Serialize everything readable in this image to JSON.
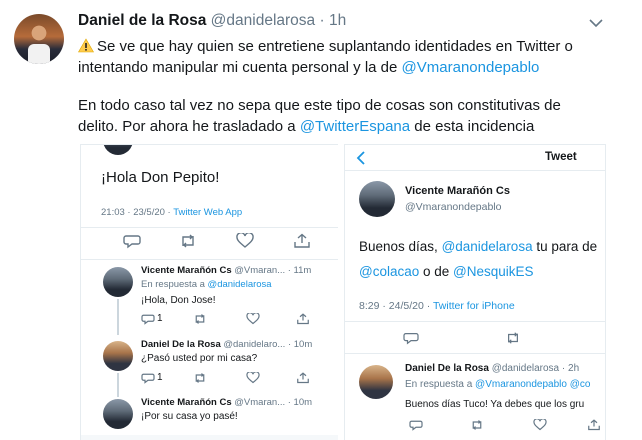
{
  "tweet": {
    "author_name": "Daniel de la Rosa",
    "author_handle": "@danidelarosa",
    "separator": "·",
    "time": "1h",
    "line1_pre": "Se ve que hay quien se entretiene suplantando identidades en Twitter o",
    "line2_pre": "intentando manipular mi cuenta personal y la de ",
    "mention1": "@Vmaranondepablo",
    "line3": "En todo caso tal vez no sepa que este tipo de cosas son constitutivas de",
    "line4_pre": "delito. Por ahora he trasladado a ",
    "mention2": "@TwitterEspana",
    "line4_post": " de esta incidencia"
  },
  "left_shot": {
    "main_text": "¡Hola Don Pepito!",
    "meta_time": "21:03 · 23/5/20 · ",
    "meta_app": "Twitter Web App",
    "replies": [
      {
        "name": "Vicente Marañón Cs",
        "handle": "@Vmaran...",
        "time": "· 11m",
        "reply_to_label": "En respuesta a ",
        "reply_to": "@danidelarosa",
        "text": "¡Hola, Don Jose!",
        "reply_count": "1"
      },
      {
        "name": "Daniel De la Rosa",
        "handle": "@danidelaro...",
        "time": "· 10m",
        "text": "¿Pasó usted por mi casa?",
        "reply_count": "1"
      },
      {
        "name": "Vicente Marañón Cs",
        "handle": "@Vmaran...",
        "time": "· 10m",
        "text": "¡Por su casa yo pasé!"
      }
    ]
  },
  "right_shot": {
    "header": "Tweet",
    "name": "Vicente Marañón Cs",
    "handle": "@Vmaranondepablo",
    "text_pre": "Buenos días, ",
    "mention1": "@danidelarosa",
    "text_mid": " tu para de",
    "mention2": "@colacao",
    "text_or": " o de ",
    "mention3": "@NesquikES",
    "meta_time": "8:29 · 24/5/20 · ",
    "meta_app": "Twitter for iPhone",
    "reply": {
      "name": "Daniel De la Rosa",
      "handle": "@danidelarosa · 2h",
      "reply_to_label": "En respuesta a ",
      "reply_to": "@Vmaranondepablo @co",
      "text": "Buenos días Tuco! Ya debes que los gru"
    }
  }
}
